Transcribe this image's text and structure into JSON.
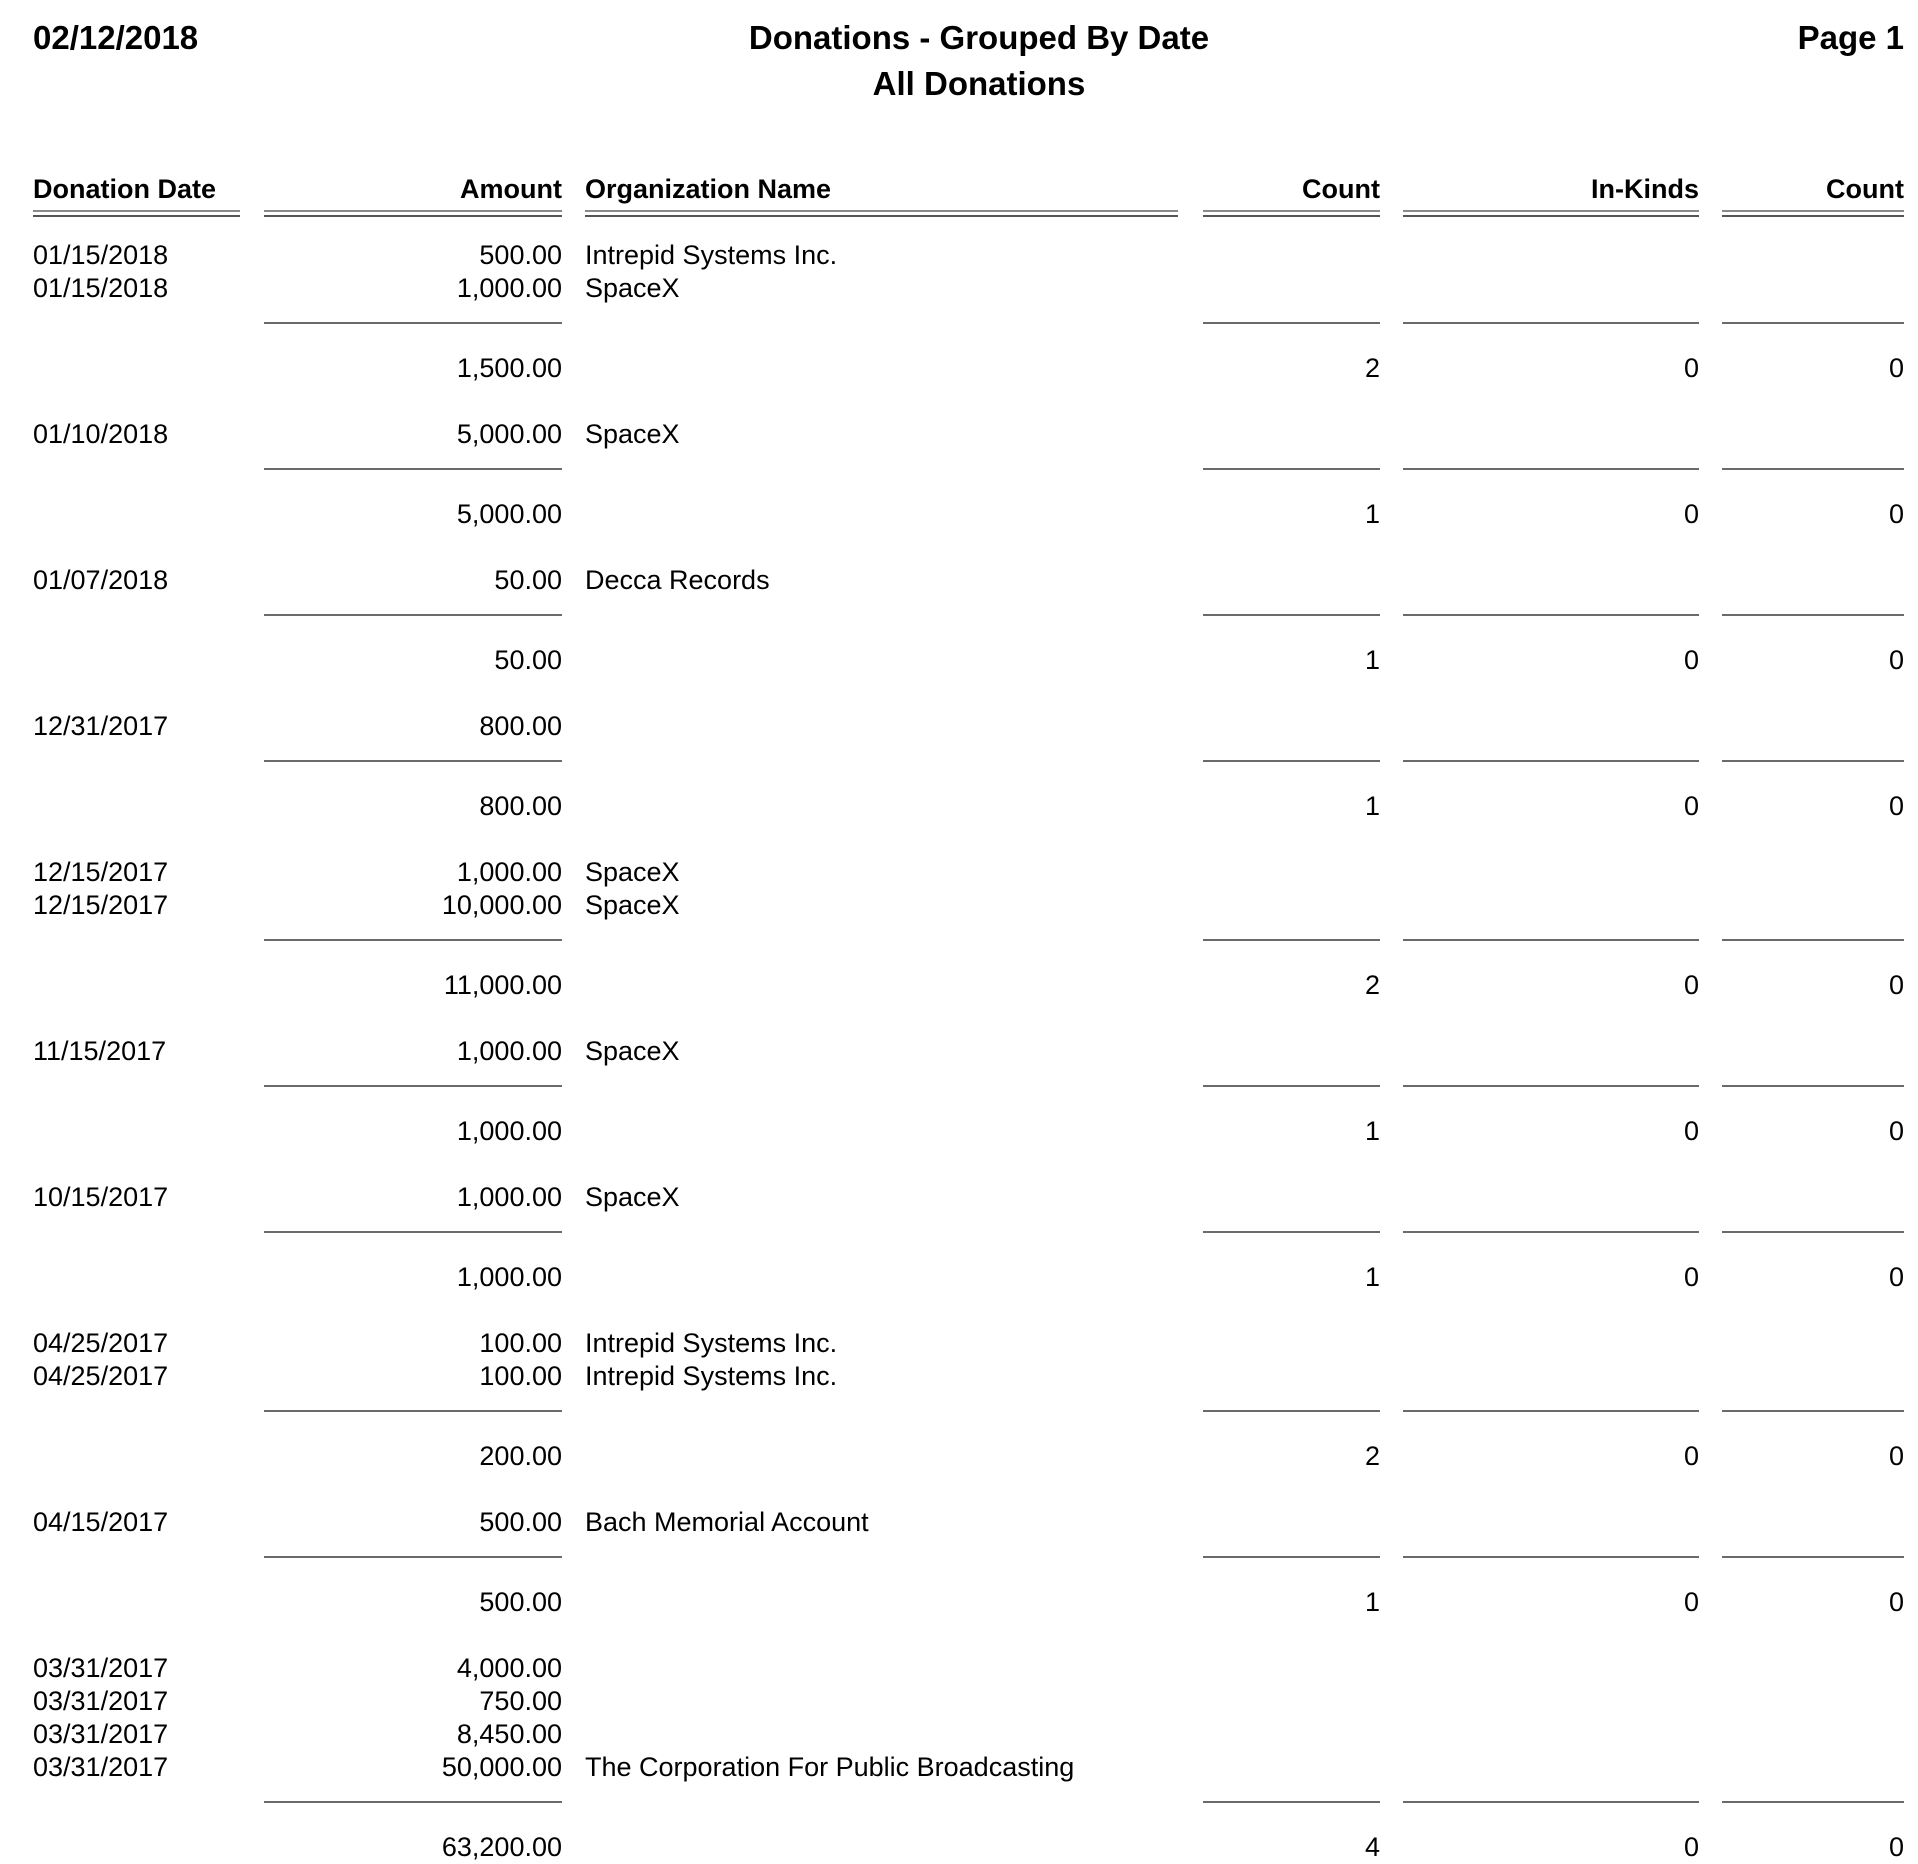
{
  "report": {
    "date": "02/12/2018",
    "title": "Donations - Grouped By Date",
    "subtitle": "All Donations",
    "page": "Page 1"
  },
  "columns": {
    "donation_date": "Donation Date",
    "amount": "Amount",
    "organization_name": "Organization Name",
    "count": "Count",
    "in_kinds": "In-Kinds",
    "in_kind_count": "Count"
  },
  "groups": [
    {
      "rows": [
        {
          "date": "01/15/2018",
          "amount": "500.00",
          "org": "Intrepid Systems Inc."
        },
        {
          "date": "01/15/2018",
          "amount": "1,000.00",
          "org": "SpaceX"
        }
      ],
      "total": "1,500.00",
      "count": "2",
      "in_kinds": "0",
      "in_kind_count": "0"
    },
    {
      "rows": [
        {
          "date": "01/10/2018",
          "amount": "5,000.00",
          "org": "SpaceX"
        }
      ],
      "total": "5,000.00",
      "count": "1",
      "in_kinds": "0",
      "in_kind_count": "0"
    },
    {
      "rows": [
        {
          "date": "01/07/2018",
          "amount": "50.00",
          "org": "Decca Records"
        }
      ],
      "total": "50.00",
      "count": "1",
      "in_kinds": "0",
      "in_kind_count": "0"
    },
    {
      "rows": [
        {
          "date": "12/31/2017",
          "amount": "800.00",
          "org": ""
        }
      ],
      "total": "800.00",
      "count": "1",
      "in_kinds": "0",
      "in_kind_count": "0"
    },
    {
      "rows": [
        {
          "date": "12/15/2017",
          "amount": "1,000.00",
          "org": "SpaceX"
        },
        {
          "date": "12/15/2017",
          "amount": "10,000.00",
          "org": "SpaceX"
        }
      ],
      "total": "11,000.00",
      "count": "2",
      "in_kinds": "0",
      "in_kind_count": "0"
    },
    {
      "rows": [
        {
          "date": "11/15/2017",
          "amount": "1,000.00",
          "org": "SpaceX"
        }
      ],
      "total": "1,000.00",
      "count": "1",
      "in_kinds": "0",
      "in_kind_count": "0"
    },
    {
      "rows": [
        {
          "date": "10/15/2017",
          "amount": "1,000.00",
          "org": "SpaceX"
        }
      ],
      "total": "1,000.00",
      "count": "1",
      "in_kinds": "0",
      "in_kind_count": "0"
    },
    {
      "rows": [
        {
          "date": "04/25/2017",
          "amount": "100.00",
          "org": "Intrepid Systems Inc."
        },
        {
          "date": "04/25/2017",
          "amount": "100.00",
          "org": "Intrepid Systems Inc."
        }
      ],
      "total": "200.00",
      "count": "2",
      "in_kinds": "0",
      "in_kind_count": "0"
    },
    {
      "rows": [
        {
          "date": "04/15/2017",
          "amount": "500.00",
          "org": "Bach Memorial Account"
        }
      ],
      "total": "500.00",
      "count": "1",
      "in_kinds": "0",
      "in_kind_count": "0"
    },
    {
      "rows": [
        {
          "date": "03/31/2017",
          "amount": "4,000.00",
          "org": ""
        },
        {
          "date": "03/31/2017",
          "amount": "750.00",
          "org": ""
        },
        {
          "date": "03/31/2017",
          "amount": "8,450.00",
          "org": ""
        },
        {
          "date": "03/31/2017",
          "amount": "50,000.00",
          "org": "The Corporation For Public Broadcasting"
        }
      ],
      "total": "63,200.00",
      "count": "4",
      "in_kinds": "0",
      "in_kind_count": "0"
    }
  ]
}
